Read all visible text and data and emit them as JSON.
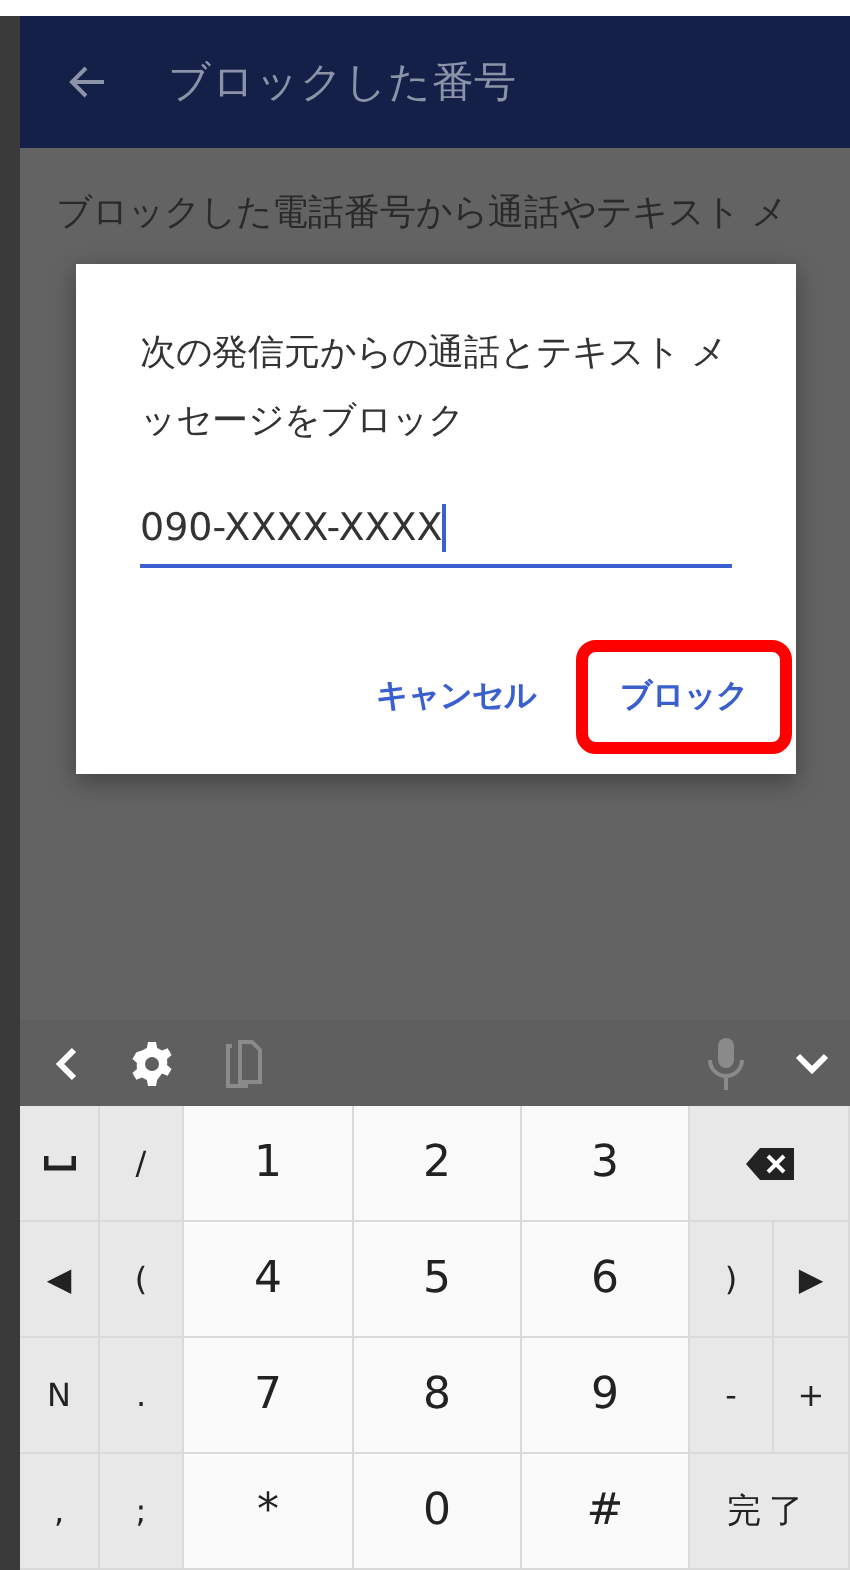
{
  "app_bar": {
    "title": "ブロックした番号"
  },
  "background": {
    "description_line": "ブロックした電話番号から通話やテキスト メ"
  },
  "dialog": {
    "message": "次の発信元からの通話とテキスト メッセージをブロック",
    "field": {
      "value": "090-XXXX-XXXX",
      "focused": true
    },
    "buttons": [
      {
        "label": "キャンセル",
        "highlighted": false
      },
      {
        "label": "ブロック",
        "highlighted": true
      }
    ]
  },
  "keyboard_toolbar": [
    {
      "kind": "back",
      "disabled": false
    },
    {
      "kind": "settings",
      "disabled": false
    },
    {
      "kind": "clipboard",
      "disabled": true
    },
    {
      "kind": "mic",
      "disabled": true
    },
    {
      "kind": "hide",
      "disabled": false
    }
  ],
  "keys": [
    [
      {
        "kind": "space"
      },
      {
        "kind": "symbol",
        "label": "/"
      },
      {
        "kind": "digit",
        "label": "1"
      },
      {
        "kind": "digit",
        "label": "2"
      },
      {
        "kind": "digit",
        "label": "3"
      },
      {
        "kind": "backspace"
      }
    ],
    [
      {
        "kind": "symbol",
        "label": "◀"
      },
      {
        "kind": "symbol",
        "label": "("
      },
      {
        "kind": "digit",
        "label": "4"
      },
      {
        "kind": "digit",
        "label": "5"
      },
      {
        "kind": "digit",
        "label": "6"
      },
      {
        "kind": "symbol",
        "label": ")"
      },
      {
        "kind": "symbol",
        "label": "▶"
      }
    ],
    [
      {
        "kind": "symbol",
        "label": "N"
      },
      {
        "kind": "symbol",
        "label": "."
      },
      {
        "kind": "digit",
        "label": "7"
      },
      {
        "kind": "digit",
        "label": "8"
      },
      {
        "kind": "digit",
        "label": "9"
      },
      {
        "kind": "symbol",
        "label": "-"
      },
      {
        "kind": "symbol",
        "label": "+"
      }
    ],
    [
      {
        "kind": "symbol",
        "label": ","
      },
      {
        "kind": "symbol",
        "label": ";"
      },
      {
        "kind": "digit",
        "label": "*"
      },
      {
        "kind": "digit",
        "label": "0"
      },
      {
        "kind": "digit",
        "label": "#"
      },
      {
        "kind": "done",
        "label": "完了"
      }
    ]
  ]
}
